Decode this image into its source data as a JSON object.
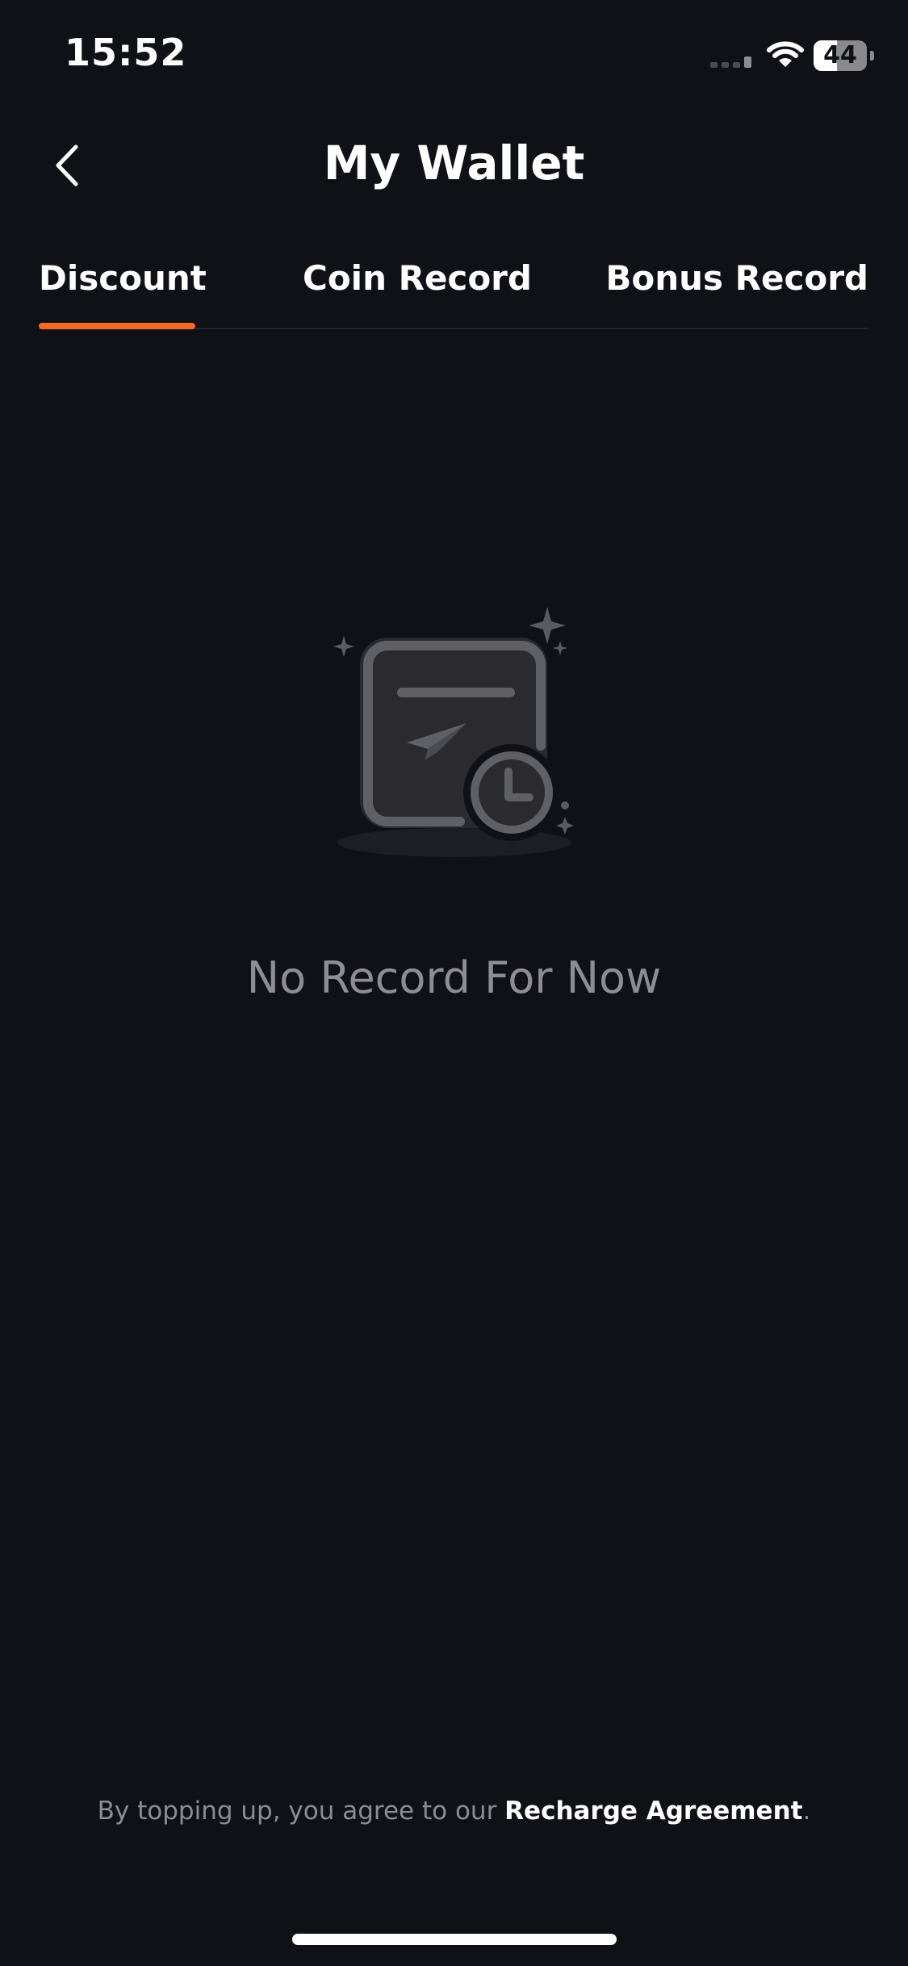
{
  "status_bar": {
    "time": "15:52",
    "battery_level": "44",
    "battery_fraction": 0.44
  },
  "header": {
    "title": "My Wallet",
    "back_icon": "chevron-left-icon"
  },
  "tabs": [
    {
      "label": "Discount",
      "active": true
    },
    {
      "label": "Coin Record",
      "active": false
    },
    {
      "label": "Bonus Record",
      "active": false
    }
  ],
  "empty_state": {
    "icon": "empty-record-icon",
    "message": "No Record For Now"
  },
  "footer": {
    "prefix": "By topping up, you agree to our ",
    "link_label": "Recharge Agreement",
    "suffix": "."
  },
  "colors": {
    "background": "#101117",
    "accent": "#f36a24",
    "muted_text": "#8d8d93"
  }
}
